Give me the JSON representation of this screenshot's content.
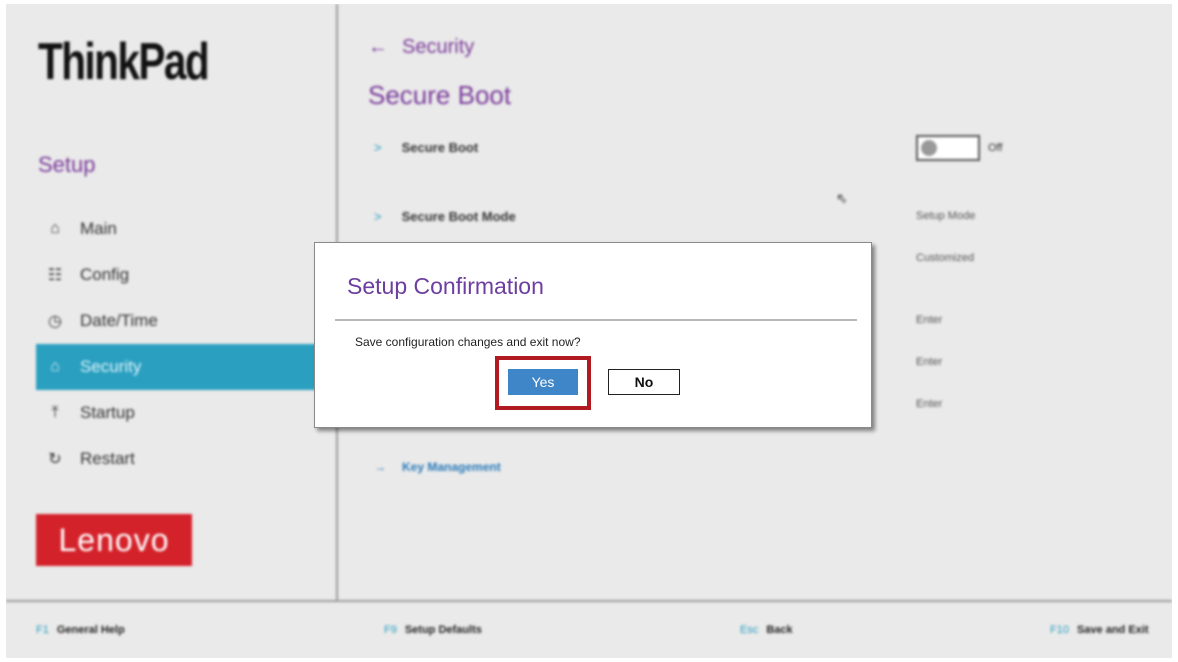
{
  "brand": {
    "product": "ThinkPad",
    "vendor": "Lenovo"
  },
  "sidebar": {
    "title": "Setup",
    "items": [
      {
        "label": "Main",
        "icon": "home-icon"
      },
      {
        "label": "Config",
        "icon": "sliders-icon"
      },
      {
        "label": "Date/Time",
        "icon": "clock-icon"
      },
      {
        "label": "Security",
        "icon": "lock-icon",
        "active": true
      },
      {
        "label": "Startup",
        "icon": "upload-icon"
      },
      {
        "label": "Restart",
        "icon": "restart-icon"
      }
    ]
  },
  "main": {
    "breadcrumb": "Security",
    "title": "Secure Boot",
    "rows": [
      {
        "label": "Secure Boot",
        "toggle": "Off"
      },
      {
        "label": "Secure Boot Mode",
        "value": "Setup Mode"
      }
    ],
    "right_values": [
      "Customized",
      "Enter",
      "Enter",
      "Enter"
    ],
    "link": "Key Management"
  },
  "footer": {
    "items": [
      {
        "key": "F1",
        "label": "General Help"
      },
      {
        "key": "F9",
        "label": "Setup Defaults"
      },
      {
        "key": "Esc",
        "label": "Back"
      },
      {
        "key": "F10",
        "label": "Save and Exit"
      }
    ]
  },
  "dialog": {
    "title": "Setup Confirmation",
    "message": "Save configuration changes and exit now?",
    "yes": "Yes",
    "no": "No"
  },
  "colors": {
    "accent": "#2a9fc0",
    "title_purple": "#7a3b9a",
    "lenovo_red": "#d4222a",
    "highlight_border": "#b01a20",
    "yes_button": "#3f86c8"
  }
}
